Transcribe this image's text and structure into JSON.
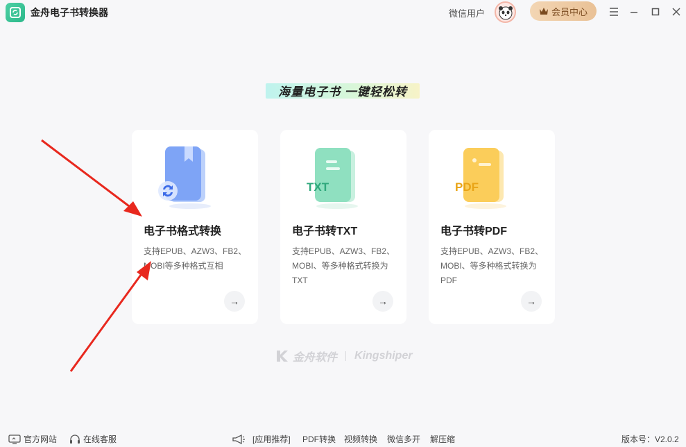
{
  "app": {
    "title": "金舟电子书转换器"
  },
  "header": {
    "user_name": "微信用户",
    "vip_label": "会员中心"
  },
  "slogan": "海量电子书 一键轻松转",
  "cards": [
    {
      "title": "电子书格式转换",
      "desc_line1": "支持EPUB、AZW3、FB2、",
      "desc_line2": "MOBI等多种格式互相",
      "desc_line3": "",
      "icon": "book-convert-icon",
      "badge": ""
    },
    {
      "title": "电子书转TXT",
      "desc_line1": "支持EPUB、AZW3、FB2、",
      "desc_line2": "MOBI、等多种格式转换为",
      "desc_line3": "TXT",
      "icon": "txt-file-icon",
      "badge": "TXT"
    },
    {
      "title": "电子书转PDF",
      "desc_line1": "支持EPUB、AZW3、FB2、",
      "desc_line2": "MOBI、等多种格式转换为",
      "desc_line3": "PDF",
      "icon": "pdf-file-icon",
      "badge": "PDF"
    }
  ],
  "brand": {
    "cn": "金舟软件",
    "en": "Kingshiper"
  },
  "footer": {
    "website": "官方网站",
    "support": "在线客服",
    "recommend": "[应用推荐]",
    "links": [
      "PDF转换",
      "视频转换",
      "微信多开",
      "解压缩"
    ],
    "version": "版本号：V2.0.2"
  },
  "colors": {
    "accent_green": "#2bb88a",
    "vip_gold": "#e9c196",
    "annotation_red": "#e8281e"
  }
}
